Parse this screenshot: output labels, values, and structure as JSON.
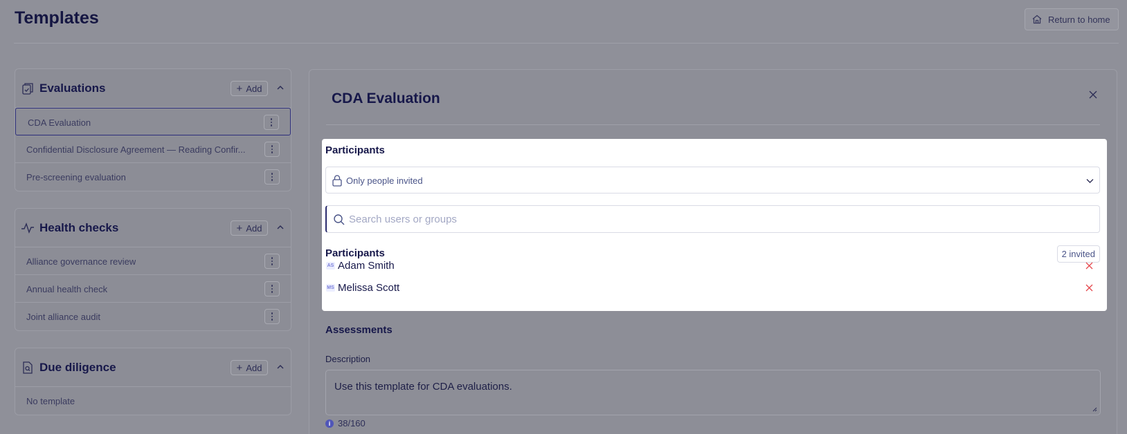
{
  "header": {
    "title": "Templates",
    "return_label": "Return to home"
  },
  "sections": [
    {
      "title": "Evaluations",
      "icon": "clipboard-check-icon",
      "add_label": "Add",
      "items": [
        "CDA Evaluation",
        "Confidential Disclosure Agreement — Reading Confir...",
        "Pre-screening evaluation"
      ],
      "selected": "CDA Evaluation"
    },
    {
      "title": "Health checks",
      "icon": "pulse-icon",
      "add_label": "Add",
      "items": [
        "Alliance governance review",
        "Annual health check",
        "Joint alliance audit"
      ]
    },
    {
      "title": "Due diligence",
      "icon": "document-search-icon",
      "add_label": "Add",
      "empty_text": "No template"
    }
  ],
  "detail": {
    "title": "CDA Evaluation",
    "participants": {
      "title": "Participants",
      "visibility": "Only people invited",
      "search_placeholder": "Search users or groups",
      "list_title": "Participants",
      "invited_count": "2 invited",
      "people": [
        {
          "initials": "AS",
          "name": "Adam Smith"
        },
        {
          "initials": "MS",
          "name": "Melissa Scott"
        }
      ]
    },
    "assessments_title": "Assessments",
    "description_label": "Description",
    "description_value": "Use this template for CDA evaluations.",
    "char_counter": "38/160"
  },
  "colors": {
    "overlay": "#8f9099",
    "text_primary": "#17184a",
    "remove": "#e5484d",
    "accent": "#5056b8"
  }
}
